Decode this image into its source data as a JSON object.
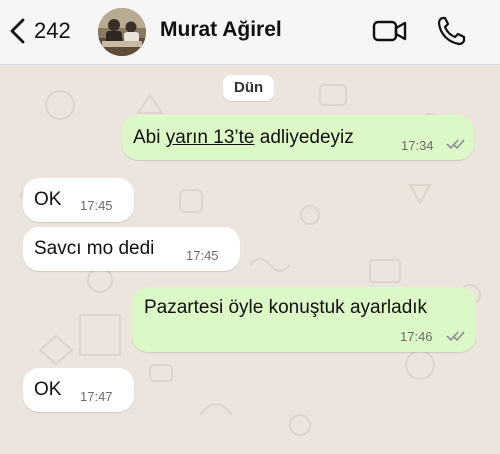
{
  "header": {
    "back_count": "242",
    "contact_name": "Murat Ağirel"
  },
  "chat": {
    "date_divider": "Dün",
    "messages": [
      {
        "direction": "outgoing",
        "text_prefix": "Abi ",
        "link_text": "yarın 13’te",
        "text_suffix": " adliyedeyiz",
        "time": "17:34",
        "status": "read"
      },
      {
        "direction": "incoming",
        "text": "OK",
        "time": "17:45"
      },
      {
        "direction": "incoming",
        "text": "Savcı mo dedi",
        "time": "17:45"
      },
      {
        "direction": "outgoing",
        "text": "Pazartesi öyle konuştuk ayarladık",
        "time": "17:46",
        "status": "read"
      },
      {
        "direction": "incoming",
        "text": "OK",
        "time": "17:47"
      }
    ]
  },
  "colors": {
    "outgoing_bubble": "#dcf8c6",
    "incoming_bubble": "#ffffff",
    "chat_background": "#ece5dd",
    "read_tick": "#8a8f96"
  },
  "icons": [
    "back-chevron-icon",
    "video-call-icon",
    "phone-call-icon",
    "read-receipt-icon"
  ]
}
